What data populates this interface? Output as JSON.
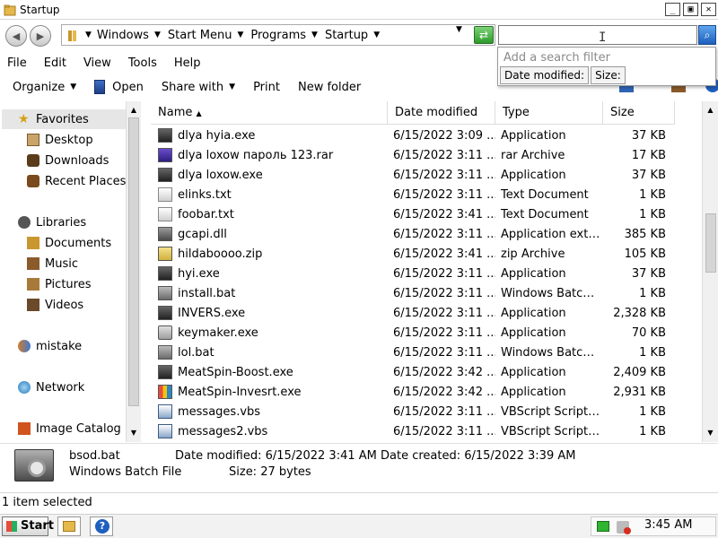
{
  "window": {
    "title": "Startup"
  },
  "address": {
    "segments": [
      "Windows",
      "Start Menu",
      "Programs",
      "Startup"
    ]
  },
  "search": {
    "placeholder": "Add a search filter",
    "filters": [
      "Date modified:",
      "Size:"
    ]
  },
  "menu": [
    "File",
    "Edit",
    "View",
    "Tools",
    "Help"
  ],
  "commands": {
    "organize": "Organize",
    "open": "Open",
    "share": "Share with",
    "print": "Print",
    "new_folder": "New folder"
  },
  "nav": {
    "favorites": "Favorites",
    "desktop": "Desktop",
    "downloads": "Downloads",
    "recent": "Recent Places",
    "libraries": "Libraries",
    "documents": "Documents",
    "music": "Music",
    "pictures": "Pictures",
    "videos": "Videos",
    "mistake": "mistake",
    "network": "Network",
    "image_catalog": "Image Catalog"
  },
  "columns": {
    "name": "Name",
    "date": "Date modified",
    "type": "Type",
    "size": "Size"
  },
  "files": [
    {
      "icon": "app",
      "name": "dlya hyia.exe",
      "date": "6/15/2022 3:09 ...",
      "type": "Application",
      "size": "37 KB"
    },
    {
      "icon": "rar",
      "name": "dlya loxow пароль 123.rar",
      "date": "6/15/2022 3:11 ...",
      "type": "rar Archive",
      "size": "17 KB"
    },
    {
      "icon": "app",
      "name": "dlya loxow.exe",
      "date": "6/15/2022 3:11 ...",
      "type": "Application",
      "size": "37 KB"
    },
    {
      "icon": "txt",
      "name": "elinks.txt",
      "date": "6/15/2022 3:11 ...",
      "type": "Text Document",
      "size": "1 KB"
    },
    {
      "icon": "txt",
      "name": "foobar.txt",
      "date": "6/15/2022 3:41 ...",
      "type": "Text Document",
      "size": "1 KB"
    },
    {
      "icon": "dll",
      "name": "gcapi.dll",
      "date": "6/15/2022 3:11 ...",
      "type": "Application exte...",
      "size": "385 KB"
    },
    {
      "icon": "zip",
      "name": "hildaboooo.zip",
      "date": "6/15/2022 3:41 ...",
      "type": "zip Archive",
      "size": "105 KB"
    },
    {
      "icon": "app",
      "name": "hyi.exe",
      "date": "6/15/2022 3:11 ...",
      "type": "Application",
      "size": "37 KB"
    },
    {
      "icon": "bat",
      "name": "install.bat",
      "date": "6/15/2022 3:11 ...",
      "type": "Windows Batch ...",
      "size": "1 KB"
    },
    {
      "icon": "app",
      "name": "INVERS.exe",
      "date": "6/15/2022 3:11 ...",
      "type": "Application",
      "size": "2,328 KB"
    },
    {
      "icon": "key",
      "name": "keymaker.exe",
      "date": "6/15/2022 3:11 ...",
      "type": "Application",
      "size": "70 KB"
    },
    {
      "icon": "bat",
      "name": "lol.bat",
      "date": "6/15/2022 3:11 ...",
      "type": "Windows Batch ...",
      "size": "1 KB"
    },
    {
      "icon": "app",
      "name": "MeatSpin-Boost.exe",
      "date": "6/15/2022 3:42 ...",
      "type": "Application",
      "size": "2,409 KB"
    },
    {
      "icon": "color",
      "name": "MeatSpin-Invesrt.exe",
      "date": "6/15/2022 3:42 ...",
      "type": "Application",
      "size": "2,931 KB"
    },
    {
      "icon": "vbs",
      "name": "messages.vbs",
      "date": "6/15/2022 3:11 ...",
      "type": "VBScript Script F...",
      "size": "1 KB"
    },
    {
      "icon": "vbs",
      "name": "messages2.vbs",
      "date": "6/15/2022 3:11 ...",
      "type": "VBScript Script F...",
      "size": "1 KB"
    }
  ],
  "details": {
    "name": "bsod.bat",
    "kind": "Windows Batch File",
    "modified": "Date modified: 6/15/2022 3:41 AM",
    "created": "Date created: 6/15/2022 3:39 AM",
    "size": "Size: 27 bytes"
  },
  "status": {
    "text": "1 item selected"
  },
  "taskbar": {
    "start": "Start",
    "clock": "3:45 AM"
  }
}
